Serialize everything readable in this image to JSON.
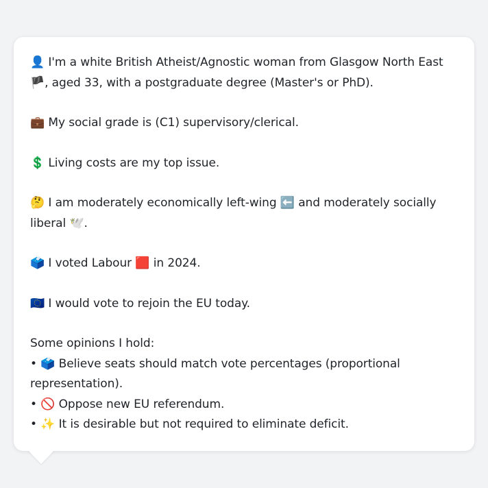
{
  "bio": {
    "identity": {
      "icon": "person-silhouette-icon",
      "icon_glyph": "👤",
      "text": "I'm a white British Atheist/Agnostic woman from Glasgow North East",
      "flag_icon": "scotland-flag-icon",
      "flag_glyph": "🏴",
      "text_after": ", aged 33, with a postgraduate degree (Master's or PhD)."
    },
    "social_grade": {
      "icon": "briefcase-icon",
      "icon_glyph": "💼",
      "text": "My social grade is (C1) supervisory/clerical."
    },
    "top_issue": {
      "icon": "dollar-sign-icon",
      "icon_glyph": "💲",
      "text": "Living costs are my top issue."
    },
    "ideology": {
      "icon": "thinking-face-icon",
      "icon_glyph": "🤔",
      "text_before": "I am moderately economically left-wing",
      "left_icon": "left-arrow-icon",
      "left_glyph": "⬅️",
      "text_middle": "and moderately socially liberal",
      "dove_icon": "dove-icon",
      "dove_glyph": "🕊️",
      "text_after": "."
    },
    "vote_2024": {
      "icon": "ballot-box-icon",
      "icon_glyph": "🗳️",
      "text_before": "I voted Labour",
      "party_icon": "red-square-icon",
      "party_glyph": "🟥",
      "text_after": "in 2024."
    },
    "eu": {
      "icon": "eu-flag-icon",
      "icon_glyph": "🇪🇺",
      "text": "I would vote to rejoin the EU today."
    },
    "opinions": {
      "heading": "Some opinions I hold:",
      "items": [
        {
          "bullet": "•",
          "icon": "ballot-box-icon",
          "icon_glyph": "🗳️",
          "text": "Believe seats should match vote percentages (proportional representation)."
        },
        {
          "bullet": "•",
          "icon": "prohibited-icon",
          "icon_glyph": "🚫",
          "text": "Oppose new EU referendum."
        },
        {
          "bullet": "•",
          "icon": "sparkles-icon",
          "icon_glyph": "✨",
          "text": "It is desirable but not required to eliminate deficit."
        }
      ]
    }
  },
  "colors": {
    "background": "#f2f3f5",
    "bubble": "#ffffff",
    "text": "#1f2328"
  }
}
